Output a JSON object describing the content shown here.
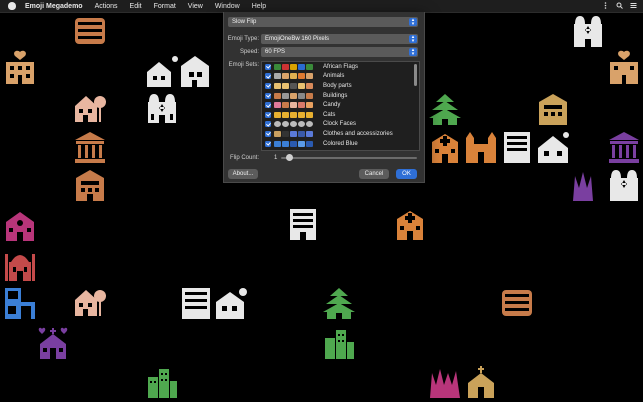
{
  "menubar": {
    "app_name": "Emoji Megademo",
    "menus": [
      "Actions",
      "Edit",
      "Format",
      "View",
      "Window",
      "Help"
    ],
    "icons": [
      "apple-icon",
      "more-icon",
      "spotlight-icon",
      "notification-center-icon"
    ]
  },
  "dialog": {
    "title_popup": "Slow Flip",
    "emoji_type_label": "Emoji Type:",
    "emoji_type_value": "EmojiOneBw 160 Pixels",
    "speed_label": "Speed:",
    "speed_value": "60 FPS",
    "emoji_sets_label": "Emoji Sets:",
    "emoji_sets": [
      {
        "label": "African Flags",
        "checked": true
      },
      {
        "label": "Animals",
        "checked": true
      },
      {
        "label": "Body parts",
        "checked": true
      },
      {
        "label": "Buildings",
        "checked": true
      },
      {
        "label": "Candy",
        "checked": true
      },
      {
        "label": "Cats",
        "checked": true
      },
      {
        "label": "Clock Faces",
        "checked": true
      },
      {
        "label": "Clothes and accessizories",
        "checked": true
      },
      {
        "label": "Colored Blue",
        "checked": true
      }
    ],
    "flip_count_label": "Flip Count:",
    "flip_count_value": "1",
    "about_button": "About...",
    "cancel_button": "Cancel",
    "ok_button": "OK"
  },
  "colors": {
    "accent": "#2f6fd6",
    "background": "#000000",
    "emoji_palette": [
      "#c77b4a",
      "#e8e8e8",
      "#d9a26a",
      "#4fa84f",
      "#b8357a",
      "#7a3fa0",
      "#c44a4a",
      "#3b7fd6",
      "#caa25a"
    ]
  }
}
